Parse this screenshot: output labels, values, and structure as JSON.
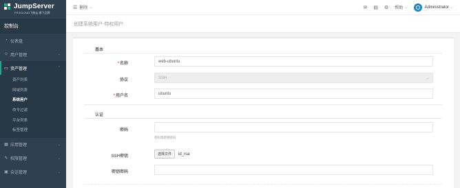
{
  "brand": {
    "name": "JumpServer",
    "tagline": "FIT2CLOUD飞致云 旗下品牌"
  },
  "sidebar": {
    "console": "控制台",
    "items": [
      {
        "label": "仪表盘",
        "icon": "dashboard-icon"
      },
      {
        "label": "用户管理",
        "icon": "users-icon"
      },
      {
        "label": "资产管理",
        "icon": "inbox-icon"
      },
      {
        "label": "应用管理",
        "icon": "grid-icon"
      },
      {
        "label": "权限管理",
        "icon": "edit-icon"
      },
      {
        "label": "会话管理",
        "icon": "desktop-icon"
      }
    ],
    "asset_submenu": [
      {
        "label": "资产列表"
      },
      {
        "label": "网域列表"
      },
      {
        "label": "系统用户"
      },
      {
        "label": "命令过滤"
      },
      {
        "label": "平台列表"
      },
      {
        "label": "标签管理"
      }
    ]
  },
  "topbar": {
    "menu_label": "删除",
    "help_label": "帮助",
    "user_name": "Administrator"
  },
  "page": {
    "heading": "创建系统用户-特权用户"
  },
  "form": {
    "section_basic": "基本",
    "name_label": "名称",
    "name_value": "web-ubuntu",
    "protocol_label": "协议",
    "protocol_value": "SSH",
    "username_label": "用户名",
    "username_value": "ubuntu",
    "section_auth": "认证",
    "password_label": "密码",
    "password_value": "",
    "password_help": "密码或密钥密码",
    "ssh_key_label": "SSH密钥",
    "file_button": "选择文件",
    "file_name": "id_rsa",
    "key_password_label": "密钥密码",
    "key_password_value": ""
  },
  "colors": {
    "sidebar_bg": "#2f4050",
    "sidebar_active": "#293846",
    "accent_green": "#19aa8d",
    "avatar_blue": "#1c84c6"
  }
}
